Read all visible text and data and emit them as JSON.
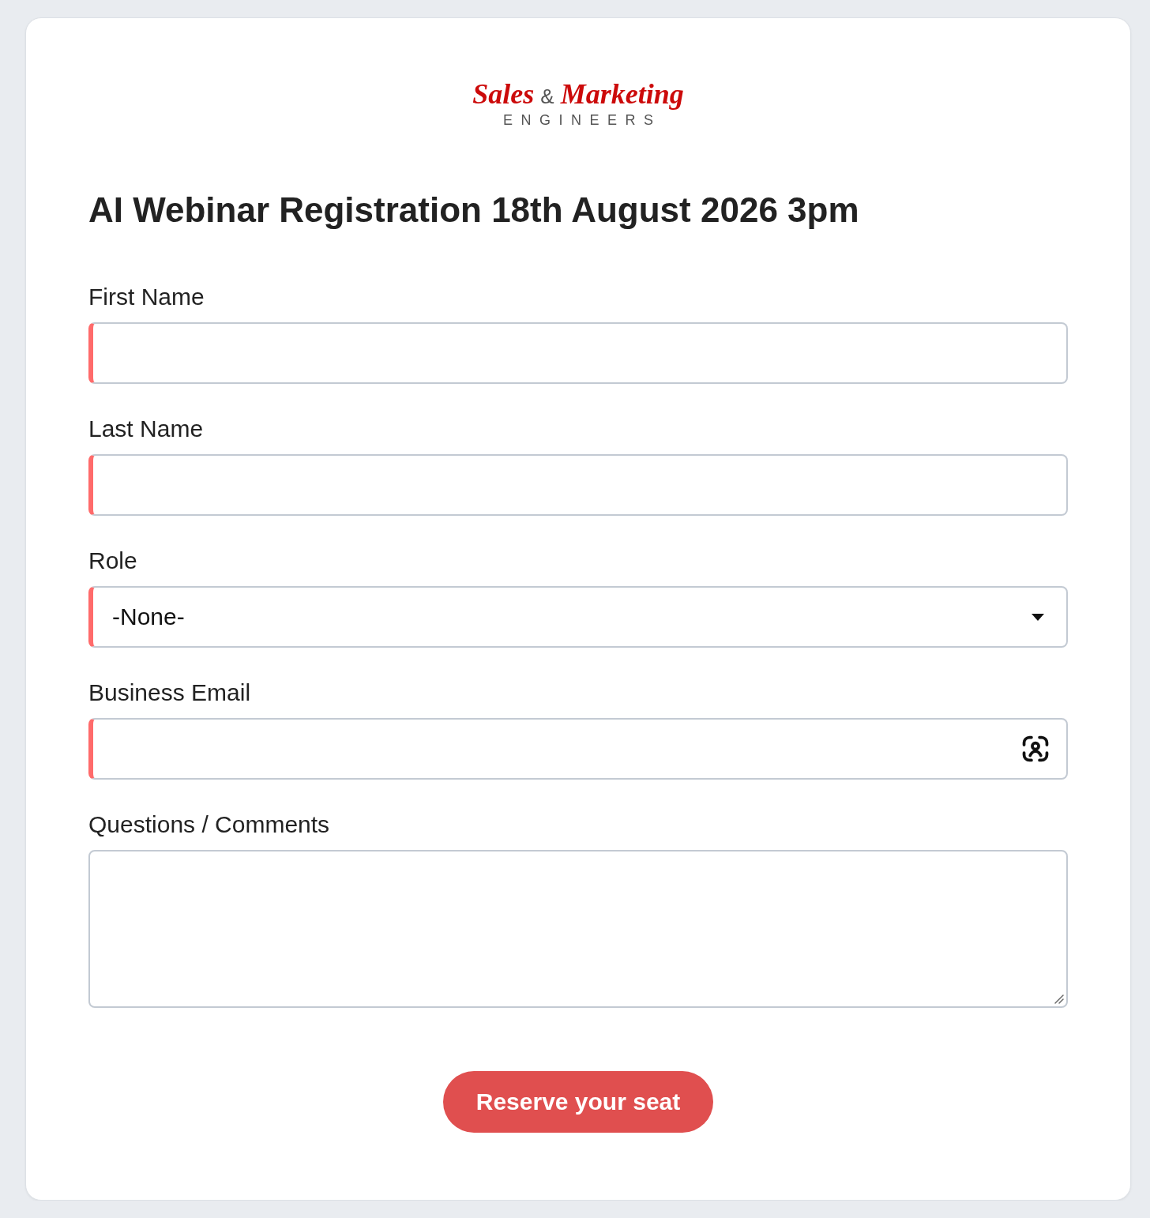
{
  "logo": {
    "script_left": "Sales",
    "ampersand": "&",
    "script_right": "Marketing",
    "subtitle": "ENGINEERS"
  },
  "form": {
    "title": "AI Webinar Registration 18th August 2026 3pm",
    "fields": [
      {
        "kind": "text",
        "label": "First Name",
        "required": true
      },
      {
        "kind": "text",
        "label": "Last Name",
        "required": true
      },
      {
        "kind": "select",
        "label": "Role",
        "value": "-None-",
        "required": true
      },
      {
        "kind": "email",
        "label": "Business Email",
        "required": true
      },
      {
        "kind": "textarea",
        "label": "Questions / Comments",
        "required": false
      }
    ],
    "submit_button": "Reserve your seat"
  }
}
